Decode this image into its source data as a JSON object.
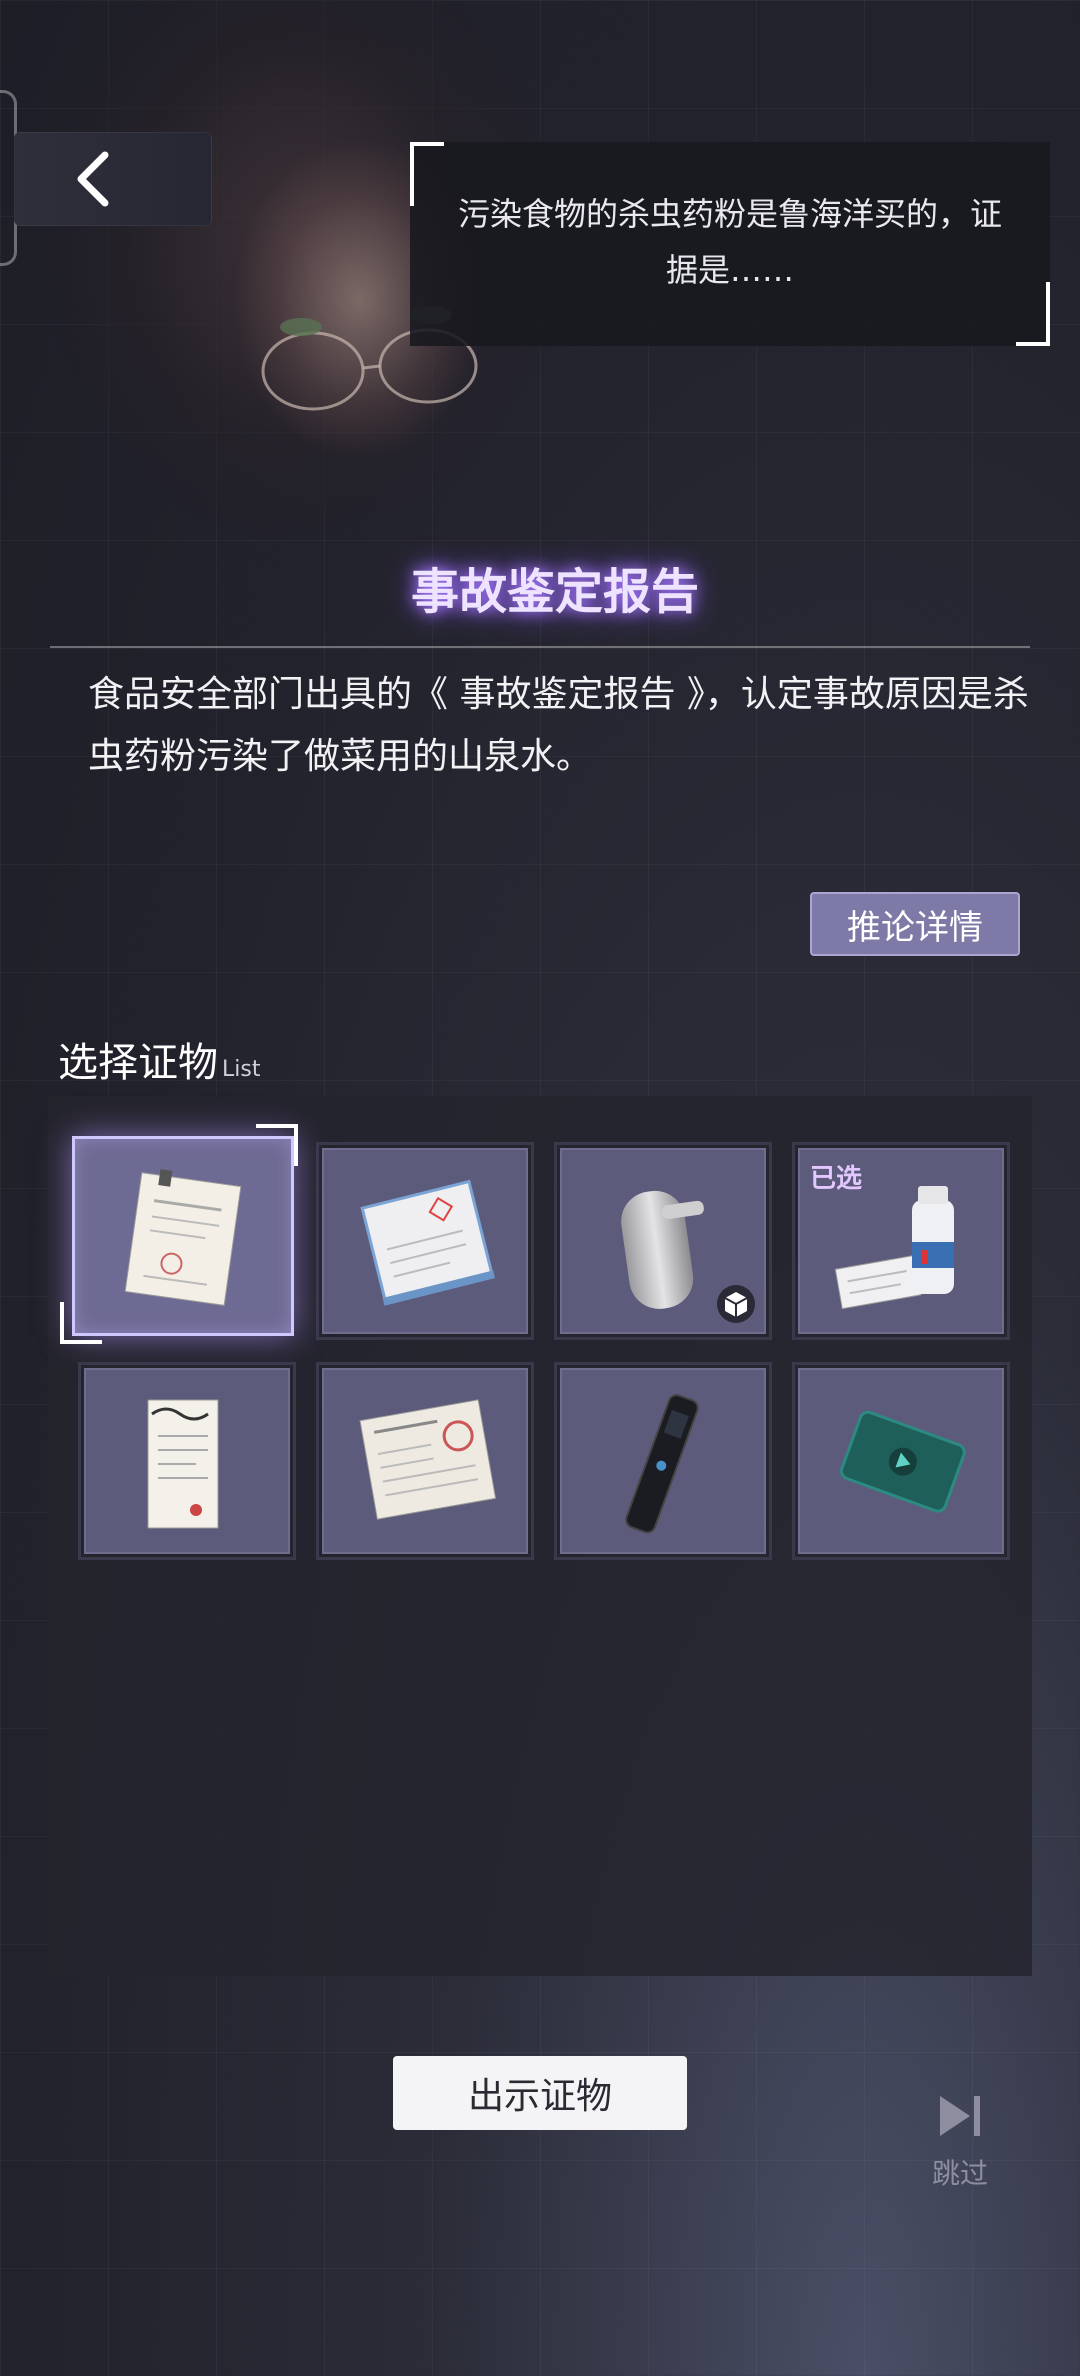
{
  "header": {
    "back_icon": "chevron-left-icon",
    "dialogue": "污染食物的杀虫药粉是鲁海洋买的，证据是……"
  },
  "report": {
    "title": "事故鉴定报告",
    "description": "食品安全部门出具的《 事故鉴定报告 》，认定事故原因是杀虫药粉污染了做菜用的山泉水。"
  },
  "detail_button": "推论详情",
  "evidence": {
    "title": "选择证物",
    "subtitle": "List",
    "items": [
      {
        "icon": "clipped-document-icon",
        "selected_focus": true,
        "tag": ""
      },
      {
        "icon": "booklet-report-icon",
        "tag": ""
      },
      {
        "icon": "soap-dispenser-icon",
        "tag": "",
        "badge_icon": "3d-cube-icon"
      },
      {
        "icon": "powder-bottle-icon",
        "tag": "已选"
      },
      {
        "icon": "receipt-icon",
        "tag": ""
      },
      {
        "icon": "fingerprint-form-icon",
        "tag": ""
      },
      {
        "icon": "voice-recorder-icon",
        "tag": ""
      },
      {
        "icon": "video-tablet-icon",
        "tag": ""
      }
    ]
  },
  "show_button": "出示证物",
  "skip": {
    "icon": "skip-forward-icon",
    "label": "跳过"
  },
  "colors": {
    "accent": "#7d7aa8",
    "title_glow": "#a678ff",
    "slot_bg": "#5c5b7b"
  }
}
